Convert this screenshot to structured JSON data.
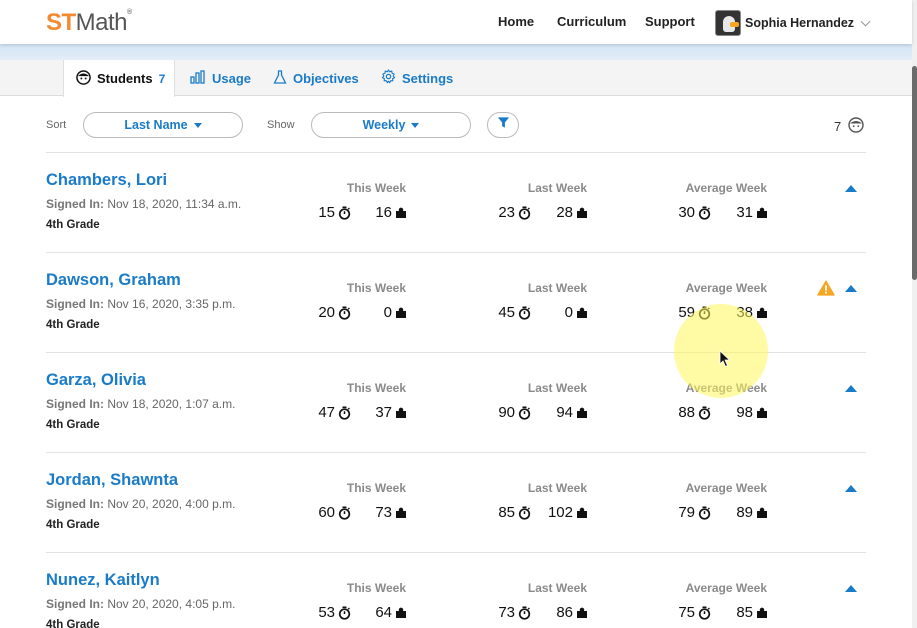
{
  "header": {
    "logo_st": "ST",
    "logo_math": "Math",
    "logo_reg": "®",
    "nav": [
      {
        "label": "Home"
      },
      {
        "label": "Curriculum"
      },
      {
        "label": "Support"
      }
    ],
    "user_name": "Sophia Hernandez"
  },
  "tabs": [
    {
      "label": "Students",
      "count": "7",
      "icon": "face-icon",
      "active": true
    },
    {
      "label": "Usage",
      "icon": "bar-chart-icon"
    },
    {
      "label": "Objectives",
      "icon": "flask-icon"
    },
    {
      "label": "Settings",
      "icon": "gear-icon"
    }
  ],
  "filters": {
    "sort_label": "Sort",
    "sort_value": "Last Name",
    "show_label": "Show",
    "show_value": "Weekly",
    "total_students": "7"
  },
  "columns": {
    "this_week": "This Week",
    "last_week": "Last Week",
    "average_week": "Average Week"
  },
  "signed_in_prefix": "Signed In:",
  "students": [
    {
      "name": "Chambers, Lori",
      "signed_in": "Nov 18, 2020, 11:34 a.m.",
      "grade": "4th Grade",
      "this_week": {
        "minutes": "15",
        "puzzles": "16"
      },
      "last_week": {
        "minutes": "23",
        "puzzles": "28"
      },
      "average_week": {
        "minutes": "30",
        "puzzles": "31"
      },
      "warning": false
    },
    {
      "name": "Dawson, Graham",
      "signed_in": "Nov 16, 2020, 3:35 p.m.",
      "grade": "4th Grade",
      "this_week": {
        "minutes": "20",
        "puzzles": "0"
      },
      "last_week": {
        "minutes": "45",
        "puzzles": "0"
      },
      "average_week": {
        "minutes": "59",
        "puzzles": "38"
      },
      "warning": true
    },
    {
      "name": "Garza, Olivia",
      "signed_in": "Nov 18, 2020, 1:07 a.m.",
      "grade": "4th Grade",
      "this_week": {
        "minutes": "47",
        "puzzles": "37"
      },
      "last_week": {
        "minutes": "90",
        "puzzles": "94"
      },
      "average_week": {
        "minutes": "88",
        "puzzles": "98"
      },
      "warning": false
    },
    {
      "name": "Jordan, Shawnta",
      "signed_in": "Nov 20, 2020, 4:00 p.m.",
      "grade": "4th Grade",
      "this_week": {
        "minutes": "60",
        "puzzles": "73"
      },
      "last_week": {
        "minutes": "85",
        "puzzles": "102"
      },
      "average_week": {
        "minutes": "79",
        "puzzles": "89"
      },
      "warning": false
    },
    {
      "name": "Nunez, Kaitlyn",
      "signed_in": "Nov 20, 2020, 4:05 p.m.",
      "grade": "4th Grade",
      "this_week": {
        "minutes": "53",
        "puzzles": "64"
      },
      "last_week": {
        "minutes": "73",
        "puzzles": "86"
      },
      "average_week": {
        "minutes": "75",
        "puzzles": "85"
      },
      "warning": false
    }
  ],
  "colors": {
    "accent": "#1a7bc9",
    "logo_orange": "#f28b30",
    "warning": "#f5a623"
  }
}
